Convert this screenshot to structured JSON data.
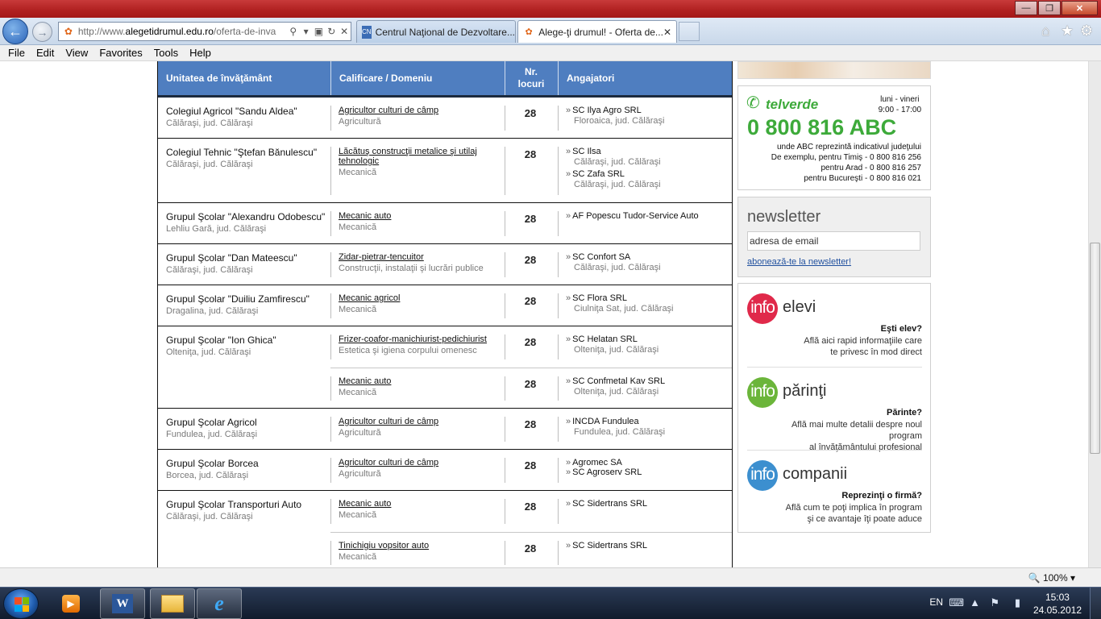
{
  "browser": {
    "address_url_prefix": "http://www.",
    "address_url_domain": "alegetidrumul.edu.ro",
    "address_url_path": "/oferta-de-inva",
    "tabs": [
      {
        "label": "Centrul Naţional de Dezvoltare..."
      },
      {
        "label": "Alege-ţi drumul! - Oferta de..."
      }
    ],
    "menu": [
      "File",
      "Edit",
      "View",
      "Favorites",
      "Tools",
      "Help"
    ],
    "zoom": "100%"
  },
  "table": {
    "headers": {
      "school": "Unitatea de învăţământ",
      "qualification": "Calificare / Domeniu",
      "places_line1": "Nr.",
      "places_line2": "locuri",
      "employers": "Angajatori"
    },
    "rows": [
      {
        "school": "Colegiul Agricol \"Sandu Aldea\"",
        "location": "Călăraşi, jud. Călăraşi",
        "quals": [
          {
            "name": "Agricultor culturi de câmp",
            "domain": "Agricultură",
            "places": "28",
            "employers": [
              {
                "name": "SC Ilya Agro SRL",
                "loc": "Floroaica, jud. Călăraşi"
              }
            ]
          }
        ]
      },
      {
        "school": "Colegiul Tehnic \"Ştefan Bănulescu\"",
        "location": "Călăraşi, jud. Călăraşi",
        "quals": [
          {
            "name": "Lăcătuş construcţii metalice şi utilaj tehnologic",
            "domain": "Mecanică",
            "places": "28",
            "employers": [
              {
                "name": "SC Ilsa",
                "loc": "Călăraşi, jud. Călăraşi"
              },
              {
                "name": "SC Zafa SRL",
                "loc": "Călăraşi, jud. Călăraşi"
              }
            ]
          }
        ]
      },
      {
        "school": "Grupul Şcolar \"Alexandru Odobescu\"",
        "location": "Lehliu Gară, jud. Călăraşi",
        "quals": [
          {
            "name": "Mecanic auto",
            "domain": "Mecanică",
            "places": "28",
            "employers": [
              {
                "name": "AF Popescu Tudor-Service Auto",
                "loc": ""
              }
            ]
          }
        ]
      },
      {
        "school": "Grupul Şcolar \"Dan Mateescu\"",
        "location": "Călăraşi, jud. Călăraşi",
        "quals": [
          {
            "name": "Zidar-pietrar-tencuitor",
            "domain": "Construcţii, instalaţii şi lucrări publice",
            "places": "28",
            "employers": [
              {
                "name": "SC Confort SA",
                "loc": "Călăraşi, jud. Călăraşi"
              }
            ]
          }
        ]
      },
      {
        "school": "Grupul Şcolar \"Duiliu Zamfirescu\"",
        "location": "Dragalina, jud. Călăraşi",
        "quals": [
          {
            "name": "Mecanic agricol",
            "domain": "Mecanică",
            "places": "28",
            "employers": [
              {
                "name": "SC Flora SRL",
                "loc": "Ciulniţa Sat, jud. Călăraşi"
              }
            ]
          }
        ]
      },
      {
        "school": "Grupul Şcolar \"Ion Ghica\"",
        "location": "Olteniţa, jud. Călăraşi",
        "quals": [
          {
            "name": "Frizer-coafor-manichiurist-pedichiurist",
            "domain": "Estetica şi igiena corpului omenesc",
            "places": "28",
            "employers": [
              {
                "name": "SC Helatan SRL",
                "loc": "Olteniţa, jud. Călăraşi"
              }
            ]
          },
          {
            "name": "Mecanic auto",
            "domain": "Mecanică",
            "places": "28",
            "employers": [
              {
                "name": "SC Confmetal Kav SRL",
                "loc": "Olteniţa, jud. Călăraşi"
              }
            ]
          }
        ]
      },
      {
        "school": "Grupul Şcolar Agricol",
        "location": "Fundulea, jud. Călăraşi",
        "quals": [
          {
            "name": "Agricultor culturi de câmp",
            "domain": "Agricultură",
            "places": "28",
            "employers": [
              {
                "name": "INCDA Fundulea",
                "loc": "Fundulea, jud. Călăraşi"
              }
            ]
          }
        ]
      },
      {
        "school": "Grupul Şcolar Borcea",
        "location": "Borcea, jud. Călăraşi",
        "quals": [
          {
            "name": "Agricultor culturi de câmp",
            "domain": "Agricultură",
            "places": "28",
            "employers": [
              {
                "name": "Agromec SA",
                "loc": ""
              },
              {
                "name": "SC Agroserv SRL",
                "loc": ""
              }
            ]
          }
        ]
      },
      {
        "school": "Grupul Şcolar Transporturi Auto",
        "location": "Călăraşi, jud. Călăraşi",
        "quals": [
          {
            "name": "Mecanic auto",
            "domain": "Mecanică",
            "places": "28",
            "employers": [
              {
                "name": "SC Sidertrans SRL",
                "loc": ""
              }
            ]
          },
          {
            "name": "Tinichigiu vopsitor auto",
            "domain": "Mecanică",
            "places": "28",
            "employers": [
              {
                "name": "SC Sidertrans SRL",
                "loc": ""
              }
            ]
          }
        ]
      }
    ]
  },
  "sidebar": {
    "telverde": {
      "brand": "telverde",
      "days": "luni - vineri",
      "hours": "9:00 - 17:00",
      "number": "0 800 816 ABC",
      "note1": "unde ABC reprezintă indicativul judeţului",
      "note2": "De exemplu, pentru Timiş - 0 800 816 256",
      "note3": "pentru Arad - 0 800 816 257",
      "note4": "pentru Bucureşti - 0 800 816 021"
    },
    "newsletter": {
      "title": "newsletter",
      "input_value": "adresa de email",
      "subscribe_link": "abonează-te la newsletter!"
    },
    "info": [
      {
        "badge": "info",
        "title": "elevi",
        "question": "Eşti elev?",
        "line1": "Află aici rapid informaţiile care",
        "line2": "te privesc în mod direct",
        "color": "#e0294a"
      },
      {
        "badge": "info",
        "title": "părinţi",
        "question": "Părinte?",
        "line1": "Află mai multe detalii despre noul program",
        "line2": "al învăţământului profesional",
        "color": "#6bb53a"
      },
      {
        "badge": "info",
        "title": "companii",
        "question": "Reprezinţi o firmă?",
        "line1": "Află cum te poţi implica în program",
        "line2": "şi ce avantaje îţi poate aduce",
        "color": "#3c8fcf"
      }
    ]
  },
  "taskbar": {
    "lang": "EN",
    "time": "15:03",
    "date": "24.05.2012"
  }
}
